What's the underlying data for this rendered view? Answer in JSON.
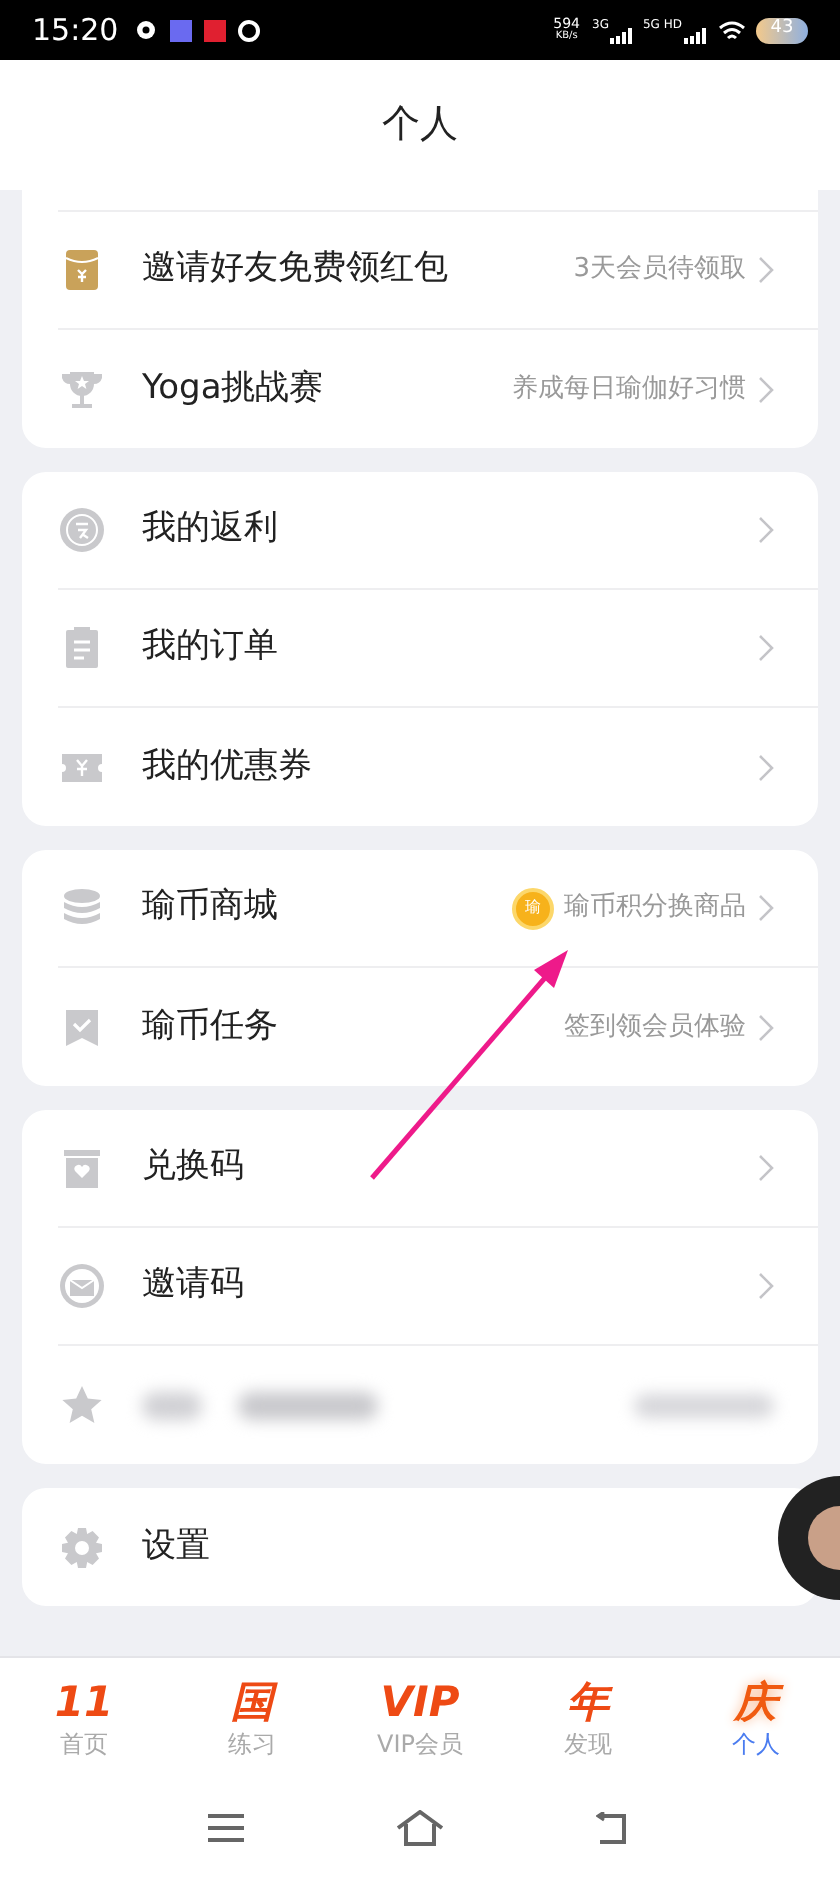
{
  "status_bar": {
    "time": "15:20",
    "speed": "594",
    "speed_unit": "KB/s",
    "signal_1": "3G",
    "signal_2": "5G HD",
    "battery": "43"
  },
  "header": {
    "title": "个人"
  },
  "groups": [
    {
      "items": [
        {
          "kind": "link",
          "label": "邀请好友免费领红包",
          "hint": "3天会员待领取"
        },
        {
          "kind": "link",
          "label": "Yoga挑战赛",
          "hint": "养成每日瑜伽好习惯"
        }
      ]
    },
    {
      "items": [
        {
          "kind": "link",
          "label": "我的返利"
        },
        {
          "kind": "link",
          "label": "我的订单"
        },
        {
          "kind": "link",
          "label": "我的优惠券"
        }
      ]
    },
    {
      "items": [
        {
          "kind": "link",
          "label": "瑜币商城",
          "hint": "瑜币积分换商品",
          "coin": "瑜"
        },
        {
          "kind": "link",
          "label": "瑜币任务",
          "hint": "签到领会员体验"
        }
      ]
    },
    {
      "items": [
        {
          "kind": "link",
          "label": "兑换码"
        },
        {
          "kind": "link",
          "label": "邀请码"
        },
        {
          "kind": "blurred"
        }
      ]
    },
    {
      "items": [
        {
          "kind": "plain",
          "label": "设置"
        }
      ]
    }
  ],
  "tabs": [
    {
      "badge": "11",
      "label": "首页",
      "selected": false
    },
    {
      "badge": "国",
      "label": "练习",
      "selected": false
    },
    {
      "badge": "VIP",
      "label": "VIP会员",
      "selected": false
    },
    {
      "badge": "年",
      "label": "发现",
      "selected": false
    },
    {
      "badge": "庆",
      "label": "个人",
      "selected": true
    }
  ]
}
